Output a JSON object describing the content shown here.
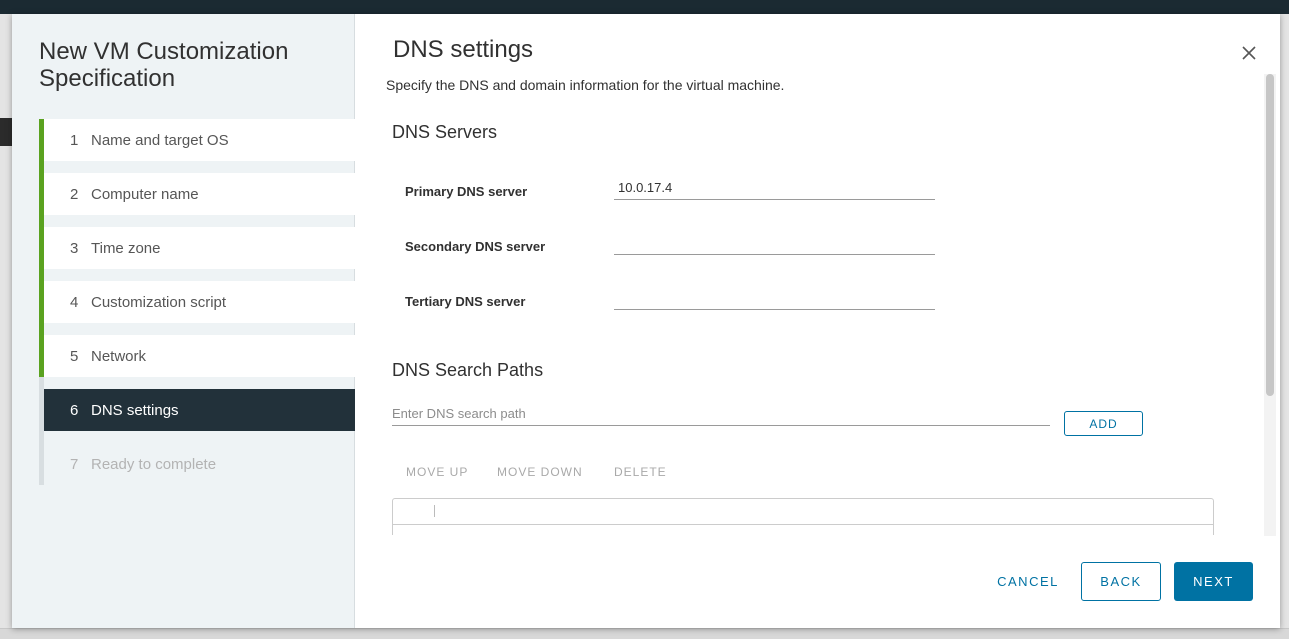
{
  "wizard": {
    "title": "New VM Customization Specification",
    "steps": [
      {
        "num": "1",
        "label": "Name and target OS"
      },
      {
        "num": "2",
        "label": "Computer name"
      },
      {
        "num": "3",
        "label": "Time zone"
      },
      {
        "num": "4",
        "label": "Customization script"
      },
      {
        "num": "5",
        "label": "Network"
      },
      {
        "num": "6",
        "label": "DNS settings"
      },
      {
        "num": "7",
        "label": "Ready to complete"
      }
    ],
    "active_step": "6"
  },
  "page": {
    "title": "DNS settings",
    "subtitle": "Specify the DNS and domain information for the virtual machine."
  },
  "dns_servers": {
    "heading": "DNS Servers",
    "primary_label": "Primary DNS server",
    "primary_value": "10.0.17.4",
    "secondary_label": "Secondary DNS server",
    "secondary_value": "",
    "tertiary_label": "Tertiary DNS server",
    "tertiary_value": ""
  },
  "search_paths": {
    "heading": "DNS Search Paths",
    "placeholder": "Enter DNS search path",
    "add_label": "ADD",
    "move_up_label": "MOVE UP",
    "move_down_label": "MOVE DOWN",
    "delete_label": "DELETE"
  },
  "footer": {
    "cancel_label": "CANCEL",
    "back_label": "BACK",
    "next_label": "NEXT"
  },
  "colors": {
    "accent": "#0072a3",
    "step_complete": "#5aa220",
    "step_active_bg": "#22313a"
  },
  "icons": {
    "close": "close-icon"
  }
}
